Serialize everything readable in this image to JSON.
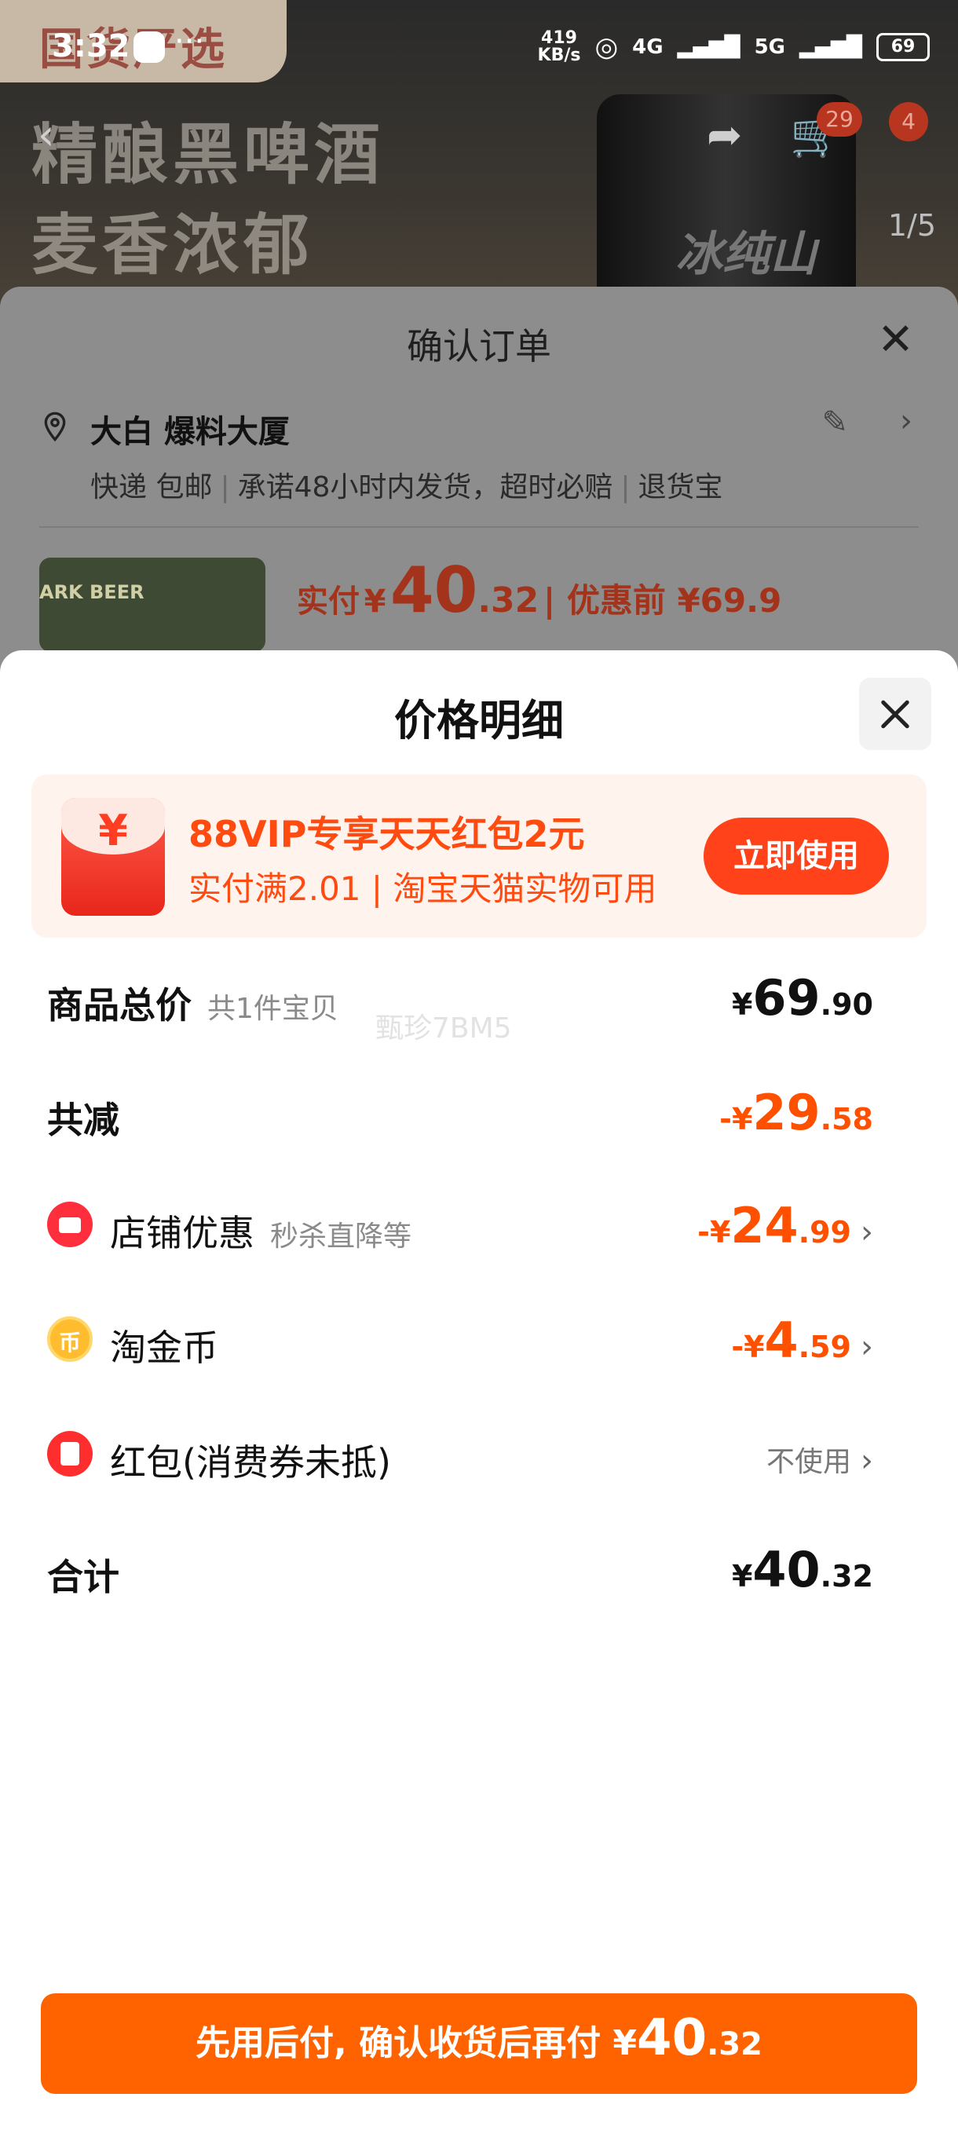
{
  "status_bar": {
    "time": "3:32",
    "more": "···",
    "net_speed_value": "419",
    "net_speed_unit": "KB/s",
    "signal_1": "4G",
    "signal_2": "5G",
    "battery": "69"
  },
  "background_page": {
    "brand": "国货严选",
    "slogan_line1": "精酿黑啤酒",
    "slogan_line2": "麦香浓郁",
    "can_brand": "冰纯山",
    "pager": "1/5",
    "cart_badge": "29",
    "msg_badge": "4"
  },
  "order_sheet": {
    "title": "确认订单",
    "address": "大白 爆料大厦",
    "shipping": [
      "快递 包邮",
      "承诺48小时内发货，超时必赔",
      "退货宝"
    ],
    "thumb_text": "ARK BEER",
    "price_label": "实付",
    "price_currency": "¥",
    "price_int": "40",
    "price_dec": ".32",
    "pre_discount": "| 优惠前 ¥69.9"
  },
  "price_detail": {
    "title": "价格明细",
    "promo": {
      "title": "88VIP专享天天红包2元",
      "subtitle": "实付满2.01 | 淘宝天猫实物可用",
      "button": "立即使用",
      "icon_symbol": "¥"
    },
    "rows": {
      "total": {
        "label": "商品总价",
        "note": "共1件宝贝",
        "currency": "¥",
        "int": "69",
        "dec": ".90"
      },
      "reduce": {
        "label": "共减",
        "currency": "-¥",
        "int": "29",
        "dec": ".58"
      },
      "shop": {
        "label": "店铺优惠",
        "note": "秒杀直降等",
        "currency": "-¥",
        "int": "24",
        "dec": ".99"
      },
      "coin": {
        "label": "淘金币",
        "currency": "-¥",
        "int": "4",
        "dec": ".59",
        "icon_symbol": "币"
      },
      "redpacket": {
        "label": "红包(消费券未抵)",
        "value": "不使用"
      },
      "sum": {
        "label": "合计",
        "currency": "¥",
        "int": "40",
        "dec": ".32"
      }
    },
    "watermark": "甄珍7BM5"
  },
  "bottom_button": {
    "text": "先用后付, 确认收货后再付 ",
    "currency": "¥",
    "int": "40",
    "dec": ".32"
  },
  "colors": {
    "accent_orange": "#ff5000",
    "button_orange": "#ff6300",
    "promo_bg": "#fff3ee"
  }
}
